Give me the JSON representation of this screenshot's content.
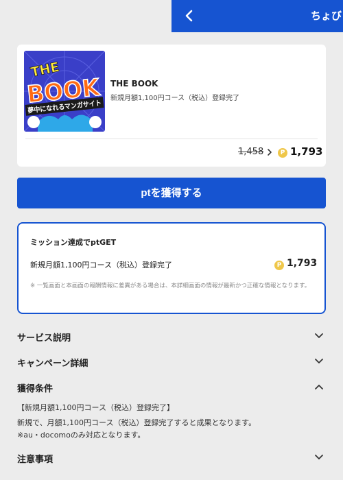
{
  "header": {
    "title": "ちょび"
  },
  "product": {
    "name": "THE BOOK",
    "description": "新規月額1,100円コース（税込）登録完了",
    "old_price": "1,458",
    "new_price": "1,793",
    "thumbnail": {
      "line1": "THE",
      "line2": "BOOK",
      "banner": "夢中になれるマンガサイト",
      "colors": {
        "bg": "#3a3fc8",
        "letters": "#ff6a13",
        "banner": "#1a1a1a"
      }
    }
  },
  "actions": {
    "get_points_label": "ptを獲得する"
  },
  "mission": {
    "title": "ミッション達成でptGET",
    "item_label": "新規月額1,100円コース（税込）登録完了",
    "points": "1,793",
    "note": "※ 一覧画面と本画面の報酬情報に差異がある場合は、本詳細画面の情報が最新かつ正確な情報となります。"
  },
  "coin_symbol": "P",
  "sections": {
    "service": "サービス説明",
    "campaign": "キャンペーン詳細",
    "conditions": "獲得条件",
    "notes": "注意事項"
  },
  "conditions": {
    "heading": "【新規月額1,100円コース（税込）登録完了】",
    "body1": "新規で、月額1,100円コース（税込）登録完了すると成果となります。",
    "body2": "※au・docomoのみ対応となります。"
  },
  "colors": {
    "accent": "#1654d1",
    "coin": "#efc74a",
    "background": "#ececec"
  }
}
